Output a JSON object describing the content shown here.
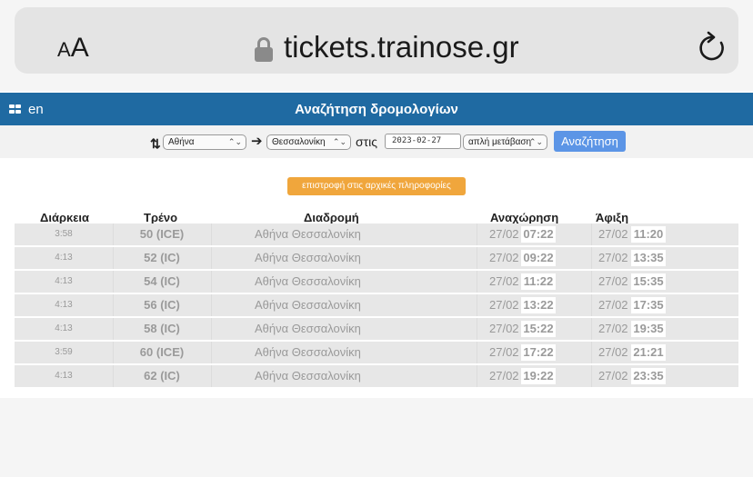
{
  "browser": {
    "text_size_small": "A",
    "text_size_large": "A",
    "url": "tickets.trainose.gr"
  },
  "header": {
    "lang": "en",
    "title": "Αναζήτηση δρομολογίων"
  },
  "search": {
    "from": "Αθήνα",
    "to": "Θεσσαλονίκη",
    "on_label": "στις",
    "date": "2023-02-27",
    "trip_type": "απλή μετάβαση",
    "button": "Αναζήτηση"
  },
  "back_button": "επιστροφή στις αρχικές πληροφορίες",
  "table": {
    "headers": {
      "duration": "Διάρκεια",
      "train": "Τρένο",
      "route": "Διαδρομή",
      "departure": "Αναχώρηση",
      "arrival": "Άφιξη"
    },
    "rows": [
      {
        "duration": "3:58",
        "train": "50 (ICE)",
        "route": "Αθήνα   Θεσσαλονίκη",
        "dep_date": "27/02",
        "dep_time": "07:22",
        "arr_date": "27/02",
        "arr_time": "11:20"
      },
      {
        "duration": "4:13",
        "train": "52 (IC)",
        "route": "Αθήνα   Θεσσαλονίκη",
        "dep_date": "27/02",
        "dep_time": "09:22",
        "arr_date": "27/02",
        "arr_time": "13:35"
      },
      {
        "duration": "4:13",
        "train": "54 (IC)",
        "route": "Αθήνα   Θεσσαλονίκη",
        "dep_date": "27/02",
        "dep_time": "11:22",
        "arr_date": "27/02",
        "arr_time": "15:35"
      },
      {
        "duration": "4:13",
        "train": "56 (IC)",
        "route": "Αθήνα   Θεσσαλονίκη",
        "dep_date": "27/02",
        "dep_time": "13:22",
        "arr_date": "27/02",
        "arr_time": "17:35"
      },
      {
        "duration": "4:13",
        "train": "58 (IC)",
        "route": "Αθήνα   Θεσσαλονίκη",
        "dep_date": "27/02",
        "dep_time": "15:22",
        "arr_date": "27/02",
        "arr_time": "19:35"
      },
      {
        "duration": "3:59",
        "train": "60 (ICE)",
        "route": "Αθήνα   Θεσσαλονίκη",
        "dep_date": "27/02",
        "dep_time": "17:22",
        "arr_date": "27/02",
        "arr_time": "21:21"
      },
      {
        "duration": "4:13",
        "train": "62 (IC)",
        "route": "Αθήνα   Θεσσαλονίκη",
        "dep_date": "27/02",
        "dep_time": "19:22",
        "arr_date": "27/02",
        "arr_time": "23:35"
      }
    ]
  },
  "colors": {
    "header_bg": "#1f6aa2",
    "search_button": "#5c95e6",
    "back_button": "#f0a63c",
    "row_bg": "#e7e7e7"
  }
}
